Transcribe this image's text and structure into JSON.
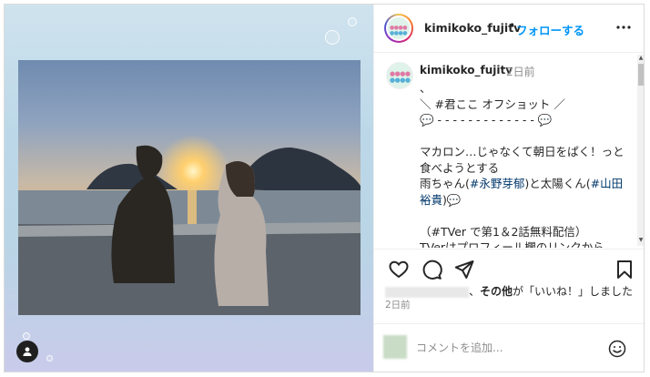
{
  "post": {
    "username": "kimikoko_fujitv",
    "separator": "•",
    "follow_label": "フォローする",
    "more_label": "•••"
  },
  "caption": {
    "username": "kimikoko_fujitv",
    "time": "2日前",
    "line1": "、",
    "line2": "＼ #君ここ オフショット ／",
    "line3": "💬 - - - - - - - - - - - - - 💬",
    "line4": "マカロン…じゃなくて朝日をぱく！っと",
    "line5": "食べようとする",
    "line6_pre": "雨ちゃん(",
    "line6_tag": "#永野芽郁",
    "line6_mid": ")と太陽くん(",
    "line6_tag2": "#山田",
    "line7_tag": "裕貴",
    "line7_post": ")💬",
    "line8": "（#TVer で第1＆2話無料配信）",
    "line9": "TVerはプロフィール欄のリンクから"
  },
  "likes": {
    "suffix_bold": "その他",
    "suffix": "が「いいね！」しました"
  },
  "date": "2日前",
  "comment": {
    "placeholder": "コメントを追加..."
  },
  "icons": [
    "more-icon",
    "heart-icon",
    "comment-icon",
    "share-icon",
    "bookmark-icon",
    "emoji-icon",
    "user-tag-icon"
  ],
  "colors": {
    "link": "#0095f6",
    "hashtag": "#00376b",
    "text": "#262626",
    "muted": "#8e8e8e"
  }
}
